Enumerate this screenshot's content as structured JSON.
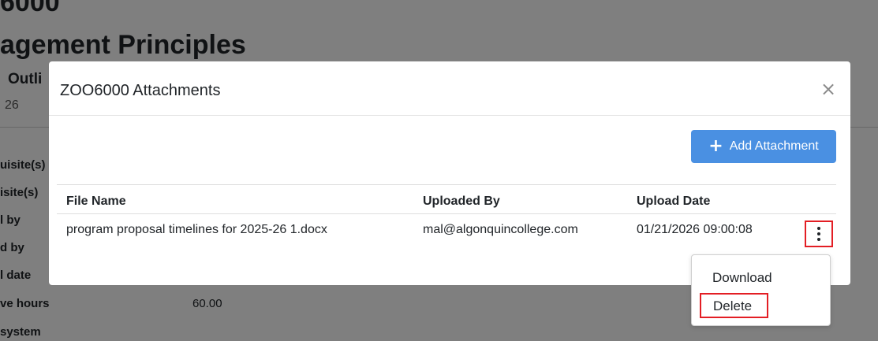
{
  "background": {
    "course_code": "6000",
    "title": "agement Principles",
    "subtitle": "Outli",
    "year": "26",
    "labels": [
      "uisite(s)",
      "isite(s)",
      "l by",
      "d by",
      "l date",
      "ve hours",
      "system"
    ],
    "contact_hours_value": "60.00"
  },
  "modal": {
    "title": "ZOO6000 Attachments",
    "close_icon": "×",
    "add_button": {
      "icon": "+",
      "label": "Add Attachment"
    },
    "table": {
      "headers": [
        "File Name",
        "Uploaded By",
        "Upload Date"
      ],
      "rows": [
        {
          "file_name": "program proposal timelines for 2025-26 1.docx",
          "uploaded_by": "mal@algonquincollege.com",
          "upload_date": "01/21/2026 09:00:08"
        }
      ]
    }
  },
  "dropdown": {
    "items": [
      "Download",
      "Delete"
    ]
  },
  "colors": {
    "accent_button": "#4a90e2",
    "highlight_red": "#e31e24",
    "overlay": "rgba(0,0,0,0.5)"
  }
}
